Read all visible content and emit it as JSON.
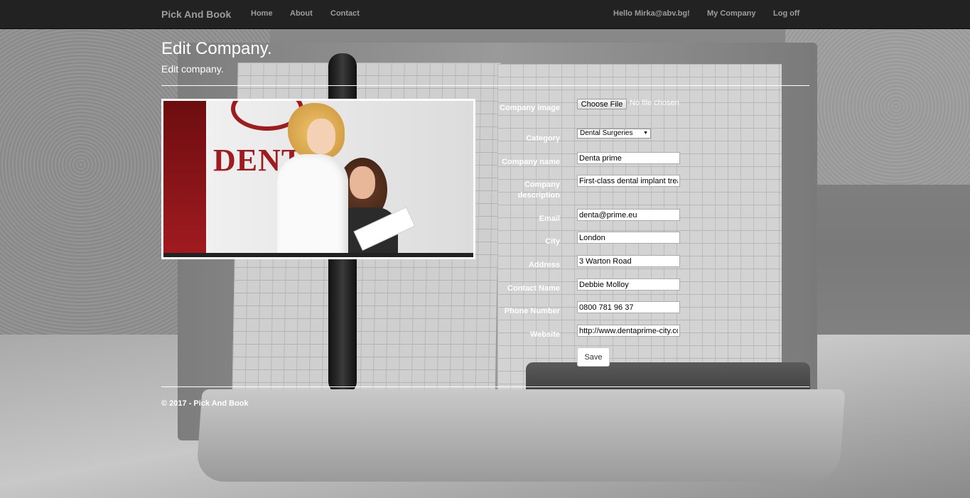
{
  "navbar": {
    "brand": "Pick And Book",
    "links": [
      "Home",
      "About",
      "Contact"
    ],
    "user_greeting": "Hello Mirka@abv.bg!",
    "my_company": "My Company",
    "logoff": "Log off"
  },
  "page": {
    "title": "Edit Company.",
    "subtitle": "Edit company."
  },
  "photo_sign": "DENTA",
  "form": {
    "image": {
      "label": "Company image",
      "button": "Choose File",
      "status": "No file chosen"
    },
    "category": {
      "label": "Category",
      "value": "Dental Surgeries"
    },
    "company_name": {
      "label": "Company name",
      "value": "Denta prime"
    },
    "description": {
      "label_line1": "Company",
      "label_line2": "description",
      "value": "First-class dental implant treat"
    },
    "email": {
      "label": "Email",
      "value": "denta@prime.eu"
    },
    "city": {
      "label": "City",
      "value": "London"
    },
    "address": {
      "label": "Address",
      "value": "3 Warton Road"
    },
    "contact_name": {
      "label": "Contact Name",
      "value": "Debbie Molloy"
    },
    "phone": {
      "label": "Phone Number",
      "value": "0800 781 96 37"
    },
    "website": {
      "label": "Website",
      "value": "http://www.dentaprime-city.co"
    },
    "save": "Save"
  },
  "footer": {
    "text": "© 2017 - Pick And Book"
  }
}
